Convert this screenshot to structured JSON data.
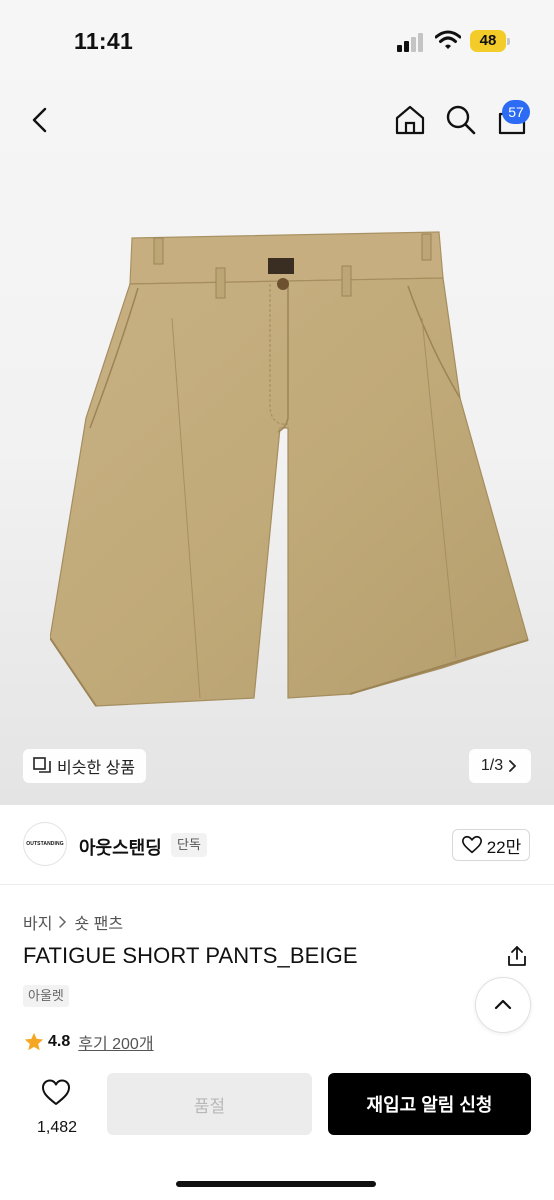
{
  "status_bar": {
    "time": "11:41",
    "battery": "48"
  },
  "header": {
    "cart_count": "57"
  },
  "gallery": {
    "similar_label": "비슷한 상품",
    "pager": "1/3"
  },
  "brand": {
    "logo_text": "OUTSTANDING",
    "name": "아웃스탠딩",
    "tag": "단독",
    "likes": "22만"
  },
  "product": {
    "breadcrumb": [
      "바지",
      "숏 팬츠"
    ],
    "title": "FATIGUE SHORT PANTS_BEIGE",
    "tag": "아울렛",
    "rating": "4.8",
    "reviews": "후기 200개"
  },
  "bottom_bar": {
    "wish_count": "1,482",
    "soldout_label": "품절",
    "restock_label": "재입고 알림 신청"
  },
  "colors": {
    "badge": "#2c6bf4",
    "star": "#f5a623",
    "primary_button": "#000000",
    "product": "#c2ac7b"
  },
  "icons": [
    "back-icon",
    "home-icon",
    "search-icon",
    "cart-icon",
    "similar-icon",
    "chevron-right-icon",
    "heart-icon",
    "share-icon",
    "chevron-up-icon",
    "star-icon"
  ]
}
